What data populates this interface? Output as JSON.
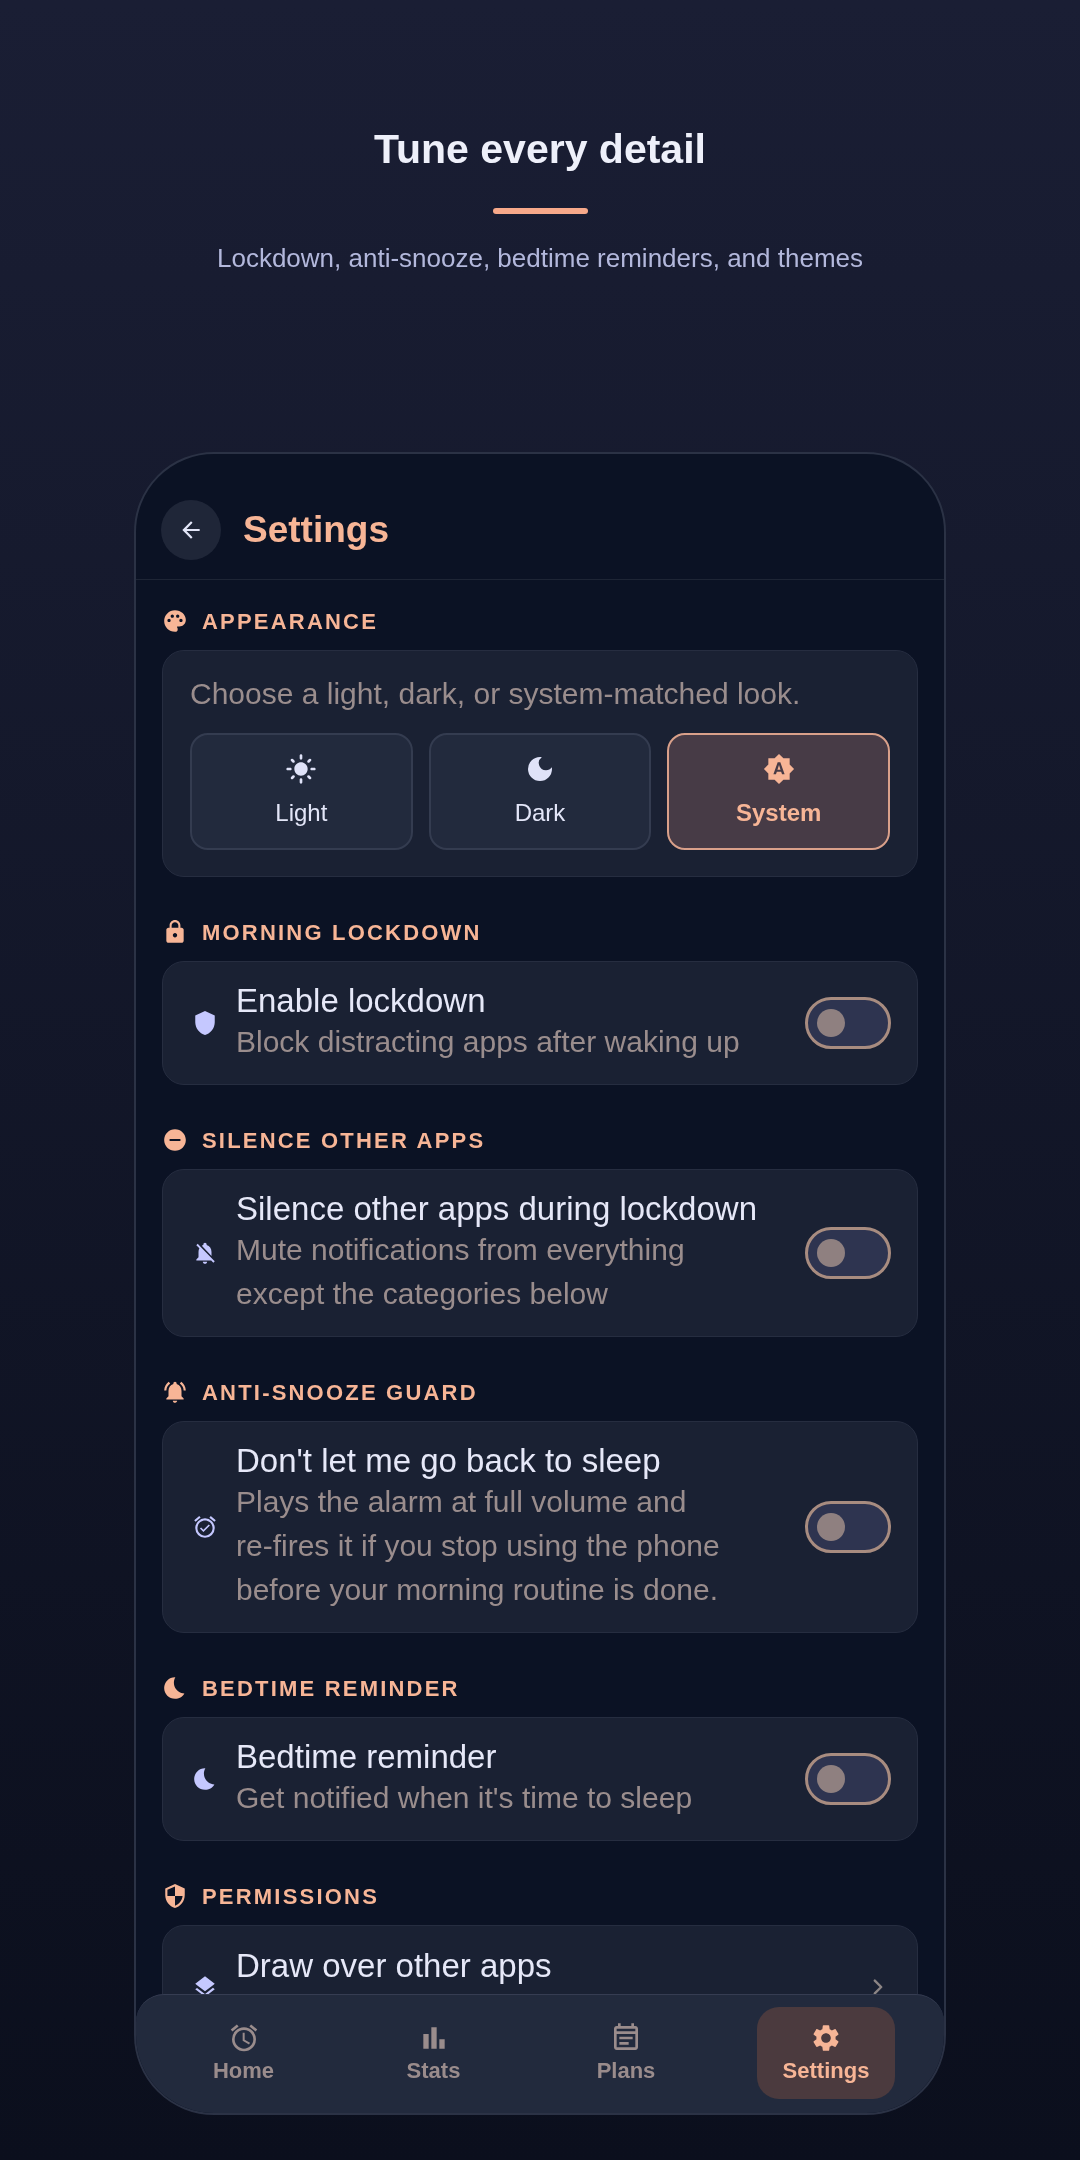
{
  "hero": {
    "title": "Tune every detail",
    "subtitle": "Lockdown, anti-snooze, bedtime reminders, and themes"
  },
  "screen": {
    "title": "Settings"
  },
  "sections": [
    {
      "kind": "theme",
      "heading": "APPEARANCE",
      "description": "Choose a light, dark, or system-matched look.",
      "options": [
        {
          "label": "Light",
          "selected": false
        },
        {
          "label": "Dark",
          "selected": false
        },
        {
          "label": "System",
          "selected": true
        }
      ]
    },
    {
      "kind": "toggle",
      "heading": "MORNING LOCKDOWN",
      "title": "Enable lockdown",
      "subtitle": "Block distracting apps after waking up",
      "on": false
    },
    {
      "kind": "toggle",
      "heading": "SILENCE OTHER APPS",
      "title": "Silence other apps during lockdown",
      "subtitle": "Mute notifications from everything except the categories below",
      "on": false
    },
    {
      "kind": "toggle",
      "heading": "ANTI-SNOOZE GUARD",
      "title": "Don't let me go back to sleep",
      "subtitle": "Plays the alarm at full volume and re-fires it if you stop using the phone before your morning routine is done.",
      "on": false
    },
    {
      "kind": "toggle",
      "heading": "BEDTIME REMINDER",
      "title": "Bedtime reminder",
      "subtitle": "Get notified when it's time to sleep",
      "on": false
    },
    {
      "kind": "link",
      "heading": "PERMISSIONS",
      "title": "Draw over other apps"
    }
  ],
  "nav": [
    {
      "label": "Home",
      "selected": false
    },
    {
      "label": "Stats",
      "selected": false
    },
    {
      "label": "Plans",
      "selected": false
    },
    {
      "label": "Settings",
      "selected": true
    }
  ]
}
